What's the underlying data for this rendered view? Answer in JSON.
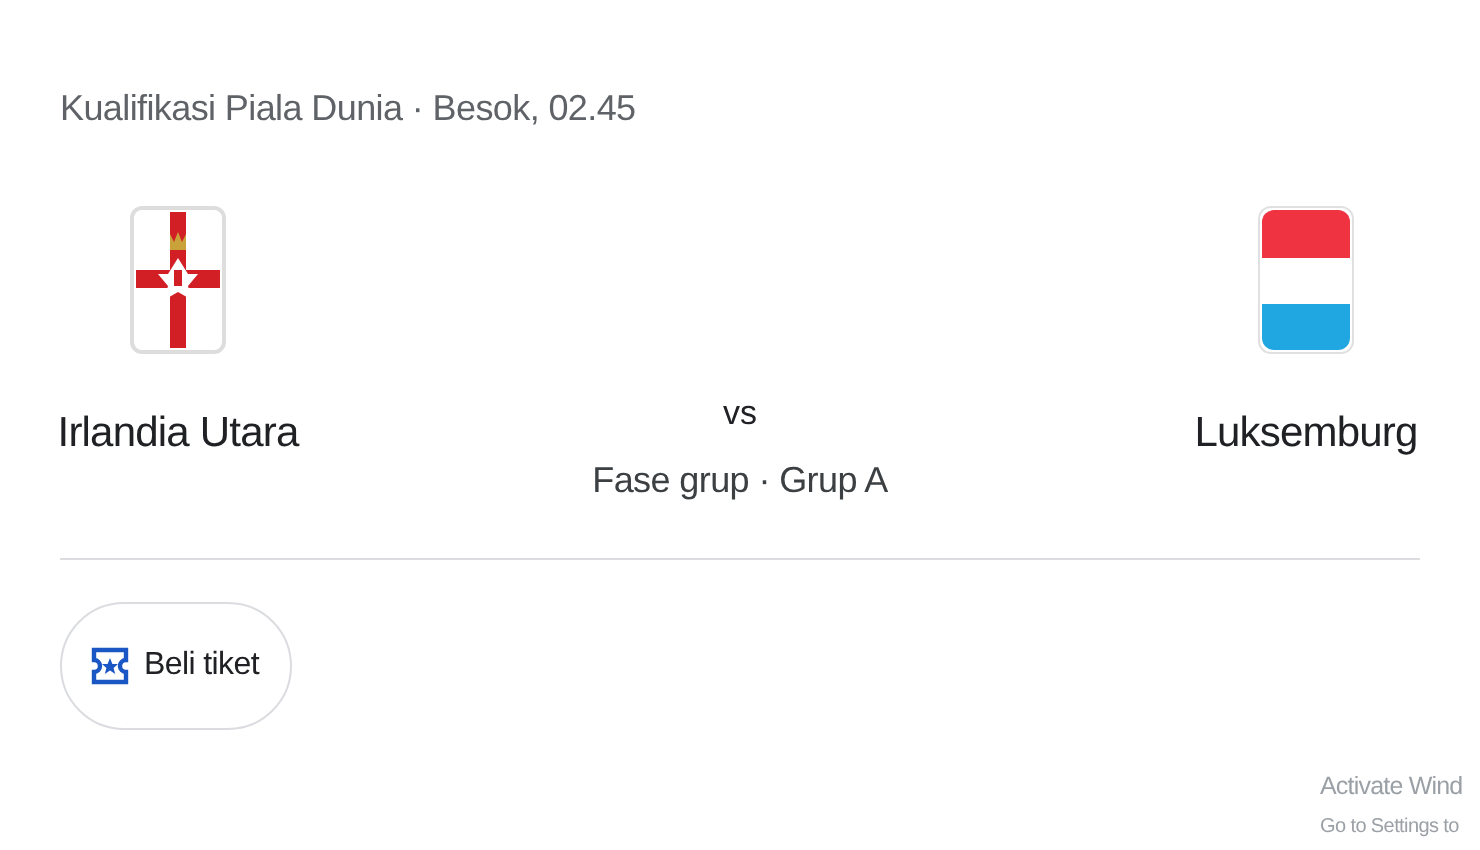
{
  "header": "Kualifikasi Piala Dunia · Besok, 02.45",
  "teams": [
    {
      "name": "Irlandia Utara",
      "kind": "northern_ireland"
    },
    {
      "name": "Luksemburg",
      "kind": "luxembourg"
    }
  ],
  "versus": "vs",
  "stage": "Fase grup · Grup A",
  "ticket_button": "Beli tiket",
  "activation_notice": {
    "title": "Activate Wind",
    "subtitle": "Go to Settings to"
  }
}
